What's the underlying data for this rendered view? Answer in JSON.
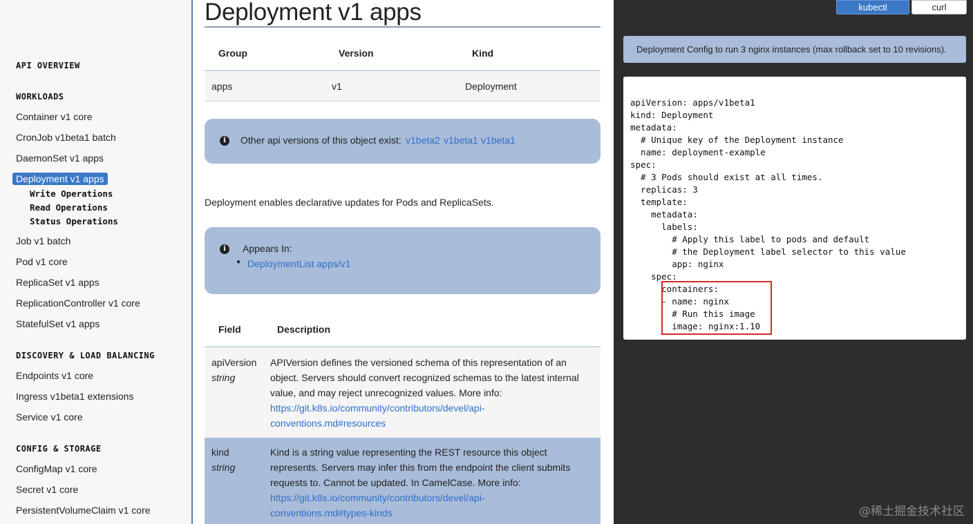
{
  "sidebar": {
    "api_overview": "API OVERVIEW",
    "workloads": "WORKLOADS",
    "workload_items": [
      "Container v1 core",
      "CronJob v1beta1 batch",
      "DaemonSet v1 apps",
      "Deployment v1 apps"
    ],
    "sub_items": [
      "Write Operations",
      "Read Operations",
      "Status Operations"
    ],
    "workload_items_2": [
      "Job v1 batch",
      "Pod v1 core",
      "ReplicaSet v1 apps",
      "ReplicationController v1 core",
      "StatefulSet v1 apps"
    ],
    "discovery": "DISCOVERY & LOAD BALANCING",
    "discovery_items": [
      "Endpoints v1 core",
      "Ingress v1beta1 extensions",
      "Service v1 core"
    ],
    "config": "CONFIG & STORAGE",
    "config_items": [
      "ConfigMap v1 core",
      "Secret v1 core",
      "PersistentVolumeClaim v1 core"
    ]
  },
  "main": {
    "title": "Deployment v1 apps",
    "gvk": {
      "headers": [
        "Group",
        "Version",
        "Kind"
      ],
      "row": [
        "apps",
        "v1",
        "Deployment"
      ]
    },
    "other_versions": {
      "text": "Other api versions of this object exist:",
      "links": [
        "v1beta2",
        "v1beta1",
        "v1beta1"
      ]
    },
    "description": "Deployment enables declarative updates for Pods and ReplicaSets.",
    "appears_in": {
      "label": "Appears In:",
      "item": "DeploymentList apps/v1"
    },
    "fields": {
      "headers": [
        "Field",
        "Description"
      ],
      "rows": [
        {
          "name": "apiVersion",
          "type": "string",
          "desc_lines": [
            "APIVersion defines the versioned schema of this representation of an",
            "object. Servers should convert recognized schemas to the latest internal",
            "value, and may reject unrecognized values. More info:"
          ],
          "link_lines": [
            "https://git.k8s.io/community/contributors/devel/api-",
            "conventions.md#resources"
          ]
        },
        {
          "name": "kind",
          "type": "string",
          "desc_lines": [
            "Kind is a string value representing the REST resource this object",
            "represents. Servers may infer this from the endpoint the client submits",
            "requests to. Cannot be updated. In CamelCase. More info:"
          ],
          "link_lines": [
            "https://git.k8s.io/community/contributors/devel/api-",
            "conventions.md#types-kinds"
          ]
        }
      ]
    }
  },
  "right": {
    "tabs": [
      "kubectl",
      "curl"
    ],
    "note": "Deployment Config to run 3 nginx instances (max rollback set to 10 revisions).",
    "code": [
      "apiVersion: apps/v1beta1",
      "kind: Deployment",
      "metadata:",
      "  # Unique key of the Deployment instance",
      "  name: deployment-example",
      "spec:",
      "  # 3 Pods should exist at all times.",
      "  replicas: 3",
      "  template:",
      "    metadata:",
      "      labels:",
      "        # Apply this label to pods and default",
      "        # the Deployment label selector to this value",
      "        app: nginx",
      "    spec:",
      "      containers:",
      "      - name: nginx",
      "        # Run this image",
      "        image: nginx:1.10"
    ],
    "highlight_color": "#d42a24"
  },
  "watermark": "@稀土掘金技术社区"
}
